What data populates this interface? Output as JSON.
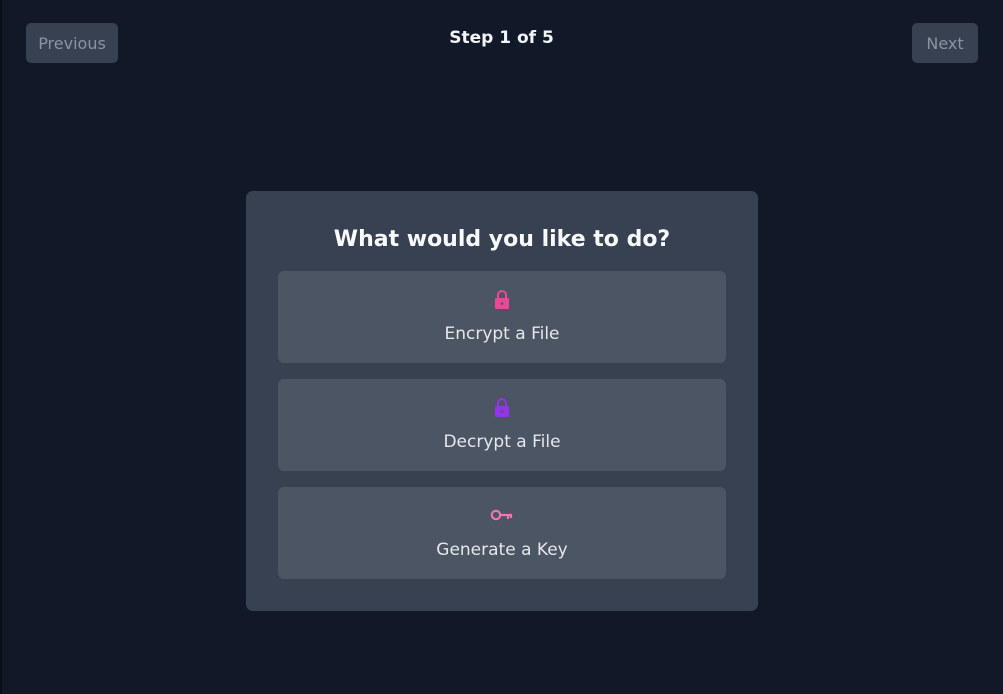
{
  "nav": {
    "previous_label": "Previous",
    "next_label": "Next",
    "step_text": "Step 1 of 5"
  },
  "card": {
    "title": "What would you like to do?",
    "options": [
      {
        "label": "Encrypt a File",
        "icon": "lock-icon",
        "color": "#ec4899"
      },
      {
        "label": "Decrypt a File",
        "icon": "lock-icon",
        "color": "#9333ea"
      },
      {
        "label": "Generate a Key",
        "icon": "key-icon",
        "color": "#f472b6"
      }
    ]
  },
  "colors": {
    "background": "#111827",
    "card": "#374151",
    "option": "#4b5563",
    "nav_button": "#374151"
  }
}
